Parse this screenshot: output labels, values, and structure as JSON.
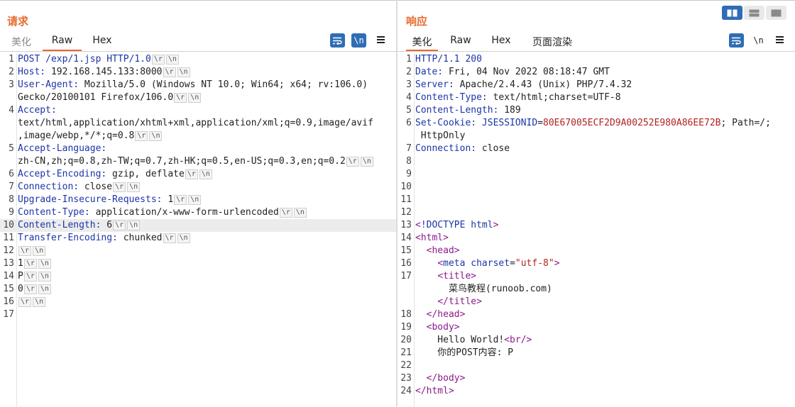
{
  "request": {
    "title": "请求",
    "tabs": [
      "美化",
      "Raw",
      "Hex"
    ],
    "active_tab": "Raw",
    "wrap_icon": "wrap-lines-icon",
    "newline_btn": "\\n",
    "lines": [
      {
        "n": "1",
        "k": "POST /exp/1.jsp HTTP/1.0",
        "v": "",
        "crlf": true
      },
      {
        "n": "2",
        "k": "Host:",
        "v": " 192.168.145.133:8000",
        "crlf": true
      },
      {
        "n": "3",
        "k": "User-Agent:",
        "v": " Mozilla/5.0 (Windows NT 10.0; Win64; x64; rv:106.0)",
        "crlf": false
      },
      {
        "n": "",
        "k": "",
        "v": "Gecko/20100101 Firefox/106.0",
        "crlf": true
      },
      {
        "n": "4",
        "k": "Accept:",
        "v": "",
        "crlf": false
      },
      {
        "n": "",
        "k": "",
        "v": "text/html,application/xhtml+xml,application/xml;q=0.9,image/avif",
        "crlf": false
      },
      {
        "n": "",
        "k": "",
        "v": ",image/webp,*/*;q=0.8",
        "crlf": true
      },
      {
        "n": "5",
        "k": "Accept-Language:",
        "v": "",
        "crlf": false
      },
      {
        "n": "",
        "k": "",
        "v": "zh-CN,zh;q=0.8,zh-TW;q=0.7,zh-HK;q=0.5,en-US;q=0.3,en;q=0.2",
        "crlf": true
      },
      {
        "n": "6",
        "k": "Accept-Encoding:",
        "v": " gzip, deflate",
        "crlf": true
      },
      {
        "n": "7",
        "k": "Connection:",
        "v": " close",
        "crlf": true
      },
      {
        "n": "8",
        "k": "Upgrade-Insecure-Requests:",
        "v": " 1",
        "crlf": true
      },
      {
        "n": "9",
        "k": "Content-Type:",
        "v": " application/x-www-form-urlencoded",
        "crlf": true
      },
      {
        "n": "10",
        "k": "Content-Length:",
        "v": " 6",
        "crlf": true,
        "hl": true
      },
      {
        "n": "11",
        "k": "Transfer-Encoding:",
        "v": " chunked",
        "crlf": true
      },
      {
        "n": "12",
        "k": "",
        "v": "",
        "crlf": true
      },
      {
        "n": "13",
        "k": "",
        "v": "1",
        "crlf": true
      },
      {
        "n": "14",
        "k": "",
        "v": "P",
        "crlf": true
      },
      {
        "n": "15",
        "k": "",
        "v": "0",
        "crlf": true
      },
      {
        "n": "16",
        "k": "",
        "v": "",
        "crlf": true
      },
      {
        "n": "17",
        "k": "",
        "v": "",
        "crlf": false
      }
    ]
  },
  "response": {
    "title": "响应",
    "tabs": [
      "美化",
      "Raw",
      "Hex",
      "页面渲染"
    ],
    "active_tab": "美化",
    "wrap_icon": "wrap-lines-icon",
    "newline_btn": "\\n",
    "header_lines": [
      {
        "n": "1",
        "k": "HTTP/1.1 200",
        "v": ""
      },
      {
        "n": "2",
        "k": "Date:",
        "v": " Fri, 04 Nov 2022 08:18:47 GMT"
      },
      {
        "n": "3",
        "k": "Server:",
        "v": " Apache/2.4.43 (Unix) PHP/7.4.32"
      },
      {
        "n": "4",
        "k": "Content-Type:",
        "v": " text/html;charset=UTF-8"
      },
      {
        "n": "5",
        "k": "Content-Length:",
        "v": " 189"
      }
    ],
    "cookie_line": {
      "n": "6",
      "k": "Set-Cookie:",
      "name": "JSESSIONID",
      "eq": "=",
      "value": "80E67005ECF2D9A00252E980A86EE72B",
      "rest": "; Path=/;",
      "cont": " HttpOnly"
    },
    "after_lines": [
      {
        "n": "7",
        "k": "Connection:",
        "v": " close"
      },
      {
        "n": "8",
        "k": "",
        "v": ""
      },
      {
        "n": "9",
        "k": "",
        "v": ""
      },
      {
        "n": "10",
        "k": "",
        "v": ""
      },
      {
        "n": "11",
        "k": "",
        "v": ""
      },
      {
        "n": "12",
        "k": "",
        "v": ""
      }
    ],
    "html_lines": [
      {
        "n": "13",
        "parts": [
          [
            "t",
            "<"
          ],
          [
            "a",
            "!DOCTYPE html"
          ],
          [
            "t",
            ">"
          ]
        ]
      },
      {
        "n": "14",
        "parts": [
          [
            "t",
            "<html>"
          ]
        ]
      },
      {
        "n": "15",
        "parts": [
          [
            "p",
            "  "
          ],
          [
            "t",
            "<head>"
          ]
        ]
      },
      {
        "n": "16",
        "parts": [
          [
            "p",
            "    "
          ],
          [
            "t",
            "<"
          ],
          [
            "a",
            "meta charset"
          ],
          [
            "p",
            "="
          ],
          [
            "s",
            "\"utf-8\""
          ],
          [
            "t",
            ">"
          ]
        ]
      },
      {
        "n": "17",
        "parts": [
          [
            "p",
            "    "
          ],
          [
            "t",
            "<title>"
          ]
        ]
      },
      {
        "n": "",
        "parts": [
          [
            "p",
            "      菜鸟教程(runoob.com)"
          ]
        ]
      },
      {
        "n": "",
        "parts": [
          [
            "p",
            "    "
          ],
          [
            "t",
            "</title>"
          ]
        ]
      },
      {
        "n": "18",
        "parts": [
          [
            "p",
            "  "
          ],
          [
            "t",
            "</head>"
          ]
        ]
      },
      {
        "n": "19",
        "parts": [
          [
            "p",
            "  "
          ],
          [
            "t",
            "<body>"
          ]
        ]
      },
      {
        "n": "20",
        "parts": [
          [
            "p",
            "    Hello World!"
          ],
          [
            "t",
            "<br/>"
          ]
        ]
      },
      {
        "n": "21",
        "parts": [
          [
            "p",
            "    你的POST内容: P"
          ]
        ]
      },
      {
        "n": "22",
        "parts": [
          [
            "p",
            ""
          ]
        ]
      },
      {
        "n": "23",
        "parts": [
          [
            "p",
            "  "
          ],
          [
            "t",
            "</body>"
          ]
        ]
      },
      {
        "n": "24",
        "parts": [
          [
            "t",
            "</html>"
          ]
        ]
      }
    ]
  },
  "colors": {
    "accent": "#e8692f",
    "button_blue": "#2f6db5",
    "header_key": "#1d35a8",
    "tag": "#8b1a8b",
    "cookie": "#b22222"
  },
  "crlf_tokens": [
    "\\r",
    "\\n"
  ]
}
